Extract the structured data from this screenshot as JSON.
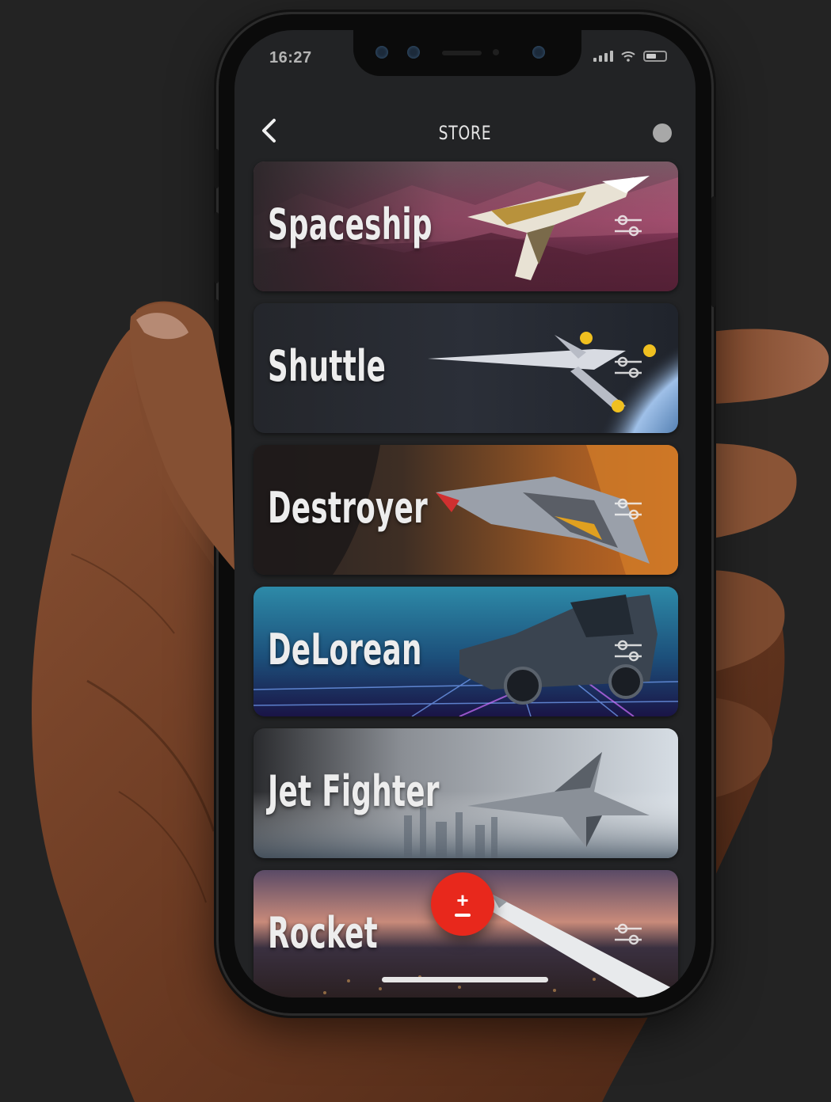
{
  "status_bar": {
    "time": "16:27"
  },
  "header": {
    "title": "STORE"
  },
  "cards": [
    {
      "label": "Spaceship"
    },
    {
      "label": "Shuttle"
    },
    {
      "label": "Destroyer"
    },
    {
      "label": "DeLorean"
    },
    {
      "label": "Jet Fighter"
    },
    {
      "label": "Rocket"
    }
  ],
  "fab": {
    "plus": "+"
  },
  "colors": {
    "background": "#232323",
    "screen": "#222325",
    "accent": "#e8281c",
    "text": "#ededed"
  },
  "icons": [
    "chevron-left-icon",
    "profile-dot-icon",
    "filter-sliders-icon",
    "plus-minus-icon"
  ]
}
